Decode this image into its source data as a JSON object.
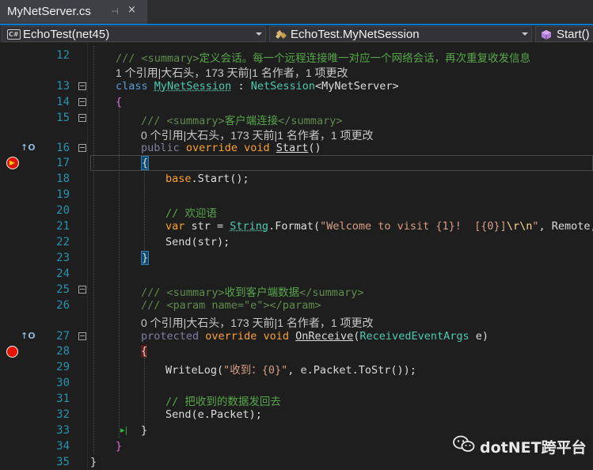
{
  "tab": {
    "title": "MyNetServer.cs",
    "pin": "⊣",
    "close": "×"
  },
  "navbar": {
    "project": "EchoTest(net45)",
    "project_icon": "C#",
    "class": "EchoTest.MyNetSession",
    "member": "Start()"
  },
  "lines": [
    {
      "n": "12"
    },
    {
      "n": "13"
    },
    {
      "n": "14"
    },
    {
      "n": "15"
    },
    {
      "n": "16"
    },
    {
      "n": "17"
    },
    {
      "n": "18"
    },
    {
      "n": "19"
    },
    {
      "n": "20"
    },
    {
      "n": "21"
    },
    {
      "n": "22"
    },
    {
      "n": "23"
    },
    {
      "n": "24"
    },
    {
      "n": "25"
    },
    {
      "n": "26"
    },
    {
      "n": "27"
    },
    {
      "n": "28"
    },
    {
      "n": "29"
    },
    {
      "n": "30"
    },
    {
      "n": "31"
    },
    {
      "n": "32"
    },
    {
      "n": "33"
    },
    {
      "n": "34"
    },
    {
      "n": "35"
    }
  ],
  "code": {
    "l12_prefix": "/// ",
    "l12_tag": "<summary>",
    "l12_text": "定义会话。每一个远程连接唯一对应一个网络会话，再次重复收发信息",
    "lens_12": "1 个引用|大石头，173 天前|1 名作者，1 项更改",
    "l13_kw": "class",
    "l13_name": "MyNetSession",
    "l13_colon": " : ",
    "l13_base": "NetSession",
    "l13_generic": "<MyNetServer>",
    "l14": "{",
    "l15_prefix": "/// ",
    "l15_tag1": "<summary>",
    "l15_text": "客户端连接",
    "l15_tag2": "</summary>",
    "lens_15": "0 个引用|大石头，173 天前|1 名作者，1 项更改",
    "l16_kw1": "public",
    "l16_kw2": "override",
    "l16_kw3": "void",
    "l16_name": "Start",
    "l16_paren": "()",
    "l17": "{",
    "l18_a": "base",
    "l18_b": ".Start",
    "l18_c": "();",
    "l20_comment": "// 欢迎语",
    "l21_kw": "var",
    "l21_a": " str = ",
    "l21_type": "String",
    "l21_b": ".Format(",
    "l21_str1": "\"Welcome to visit {1}!  [{0}]",
    "l21_esc": "\\r\\n",
    "l21_str2": "\"",
    "l21_c": ", Remote,",
    "l22": "Send(str);",
    "l23": "}",
    "l25_prefix": "/// ",
    "l25_tag1": "<summary>",
    "l25_text": "收到客户端数据",
    "l25_tag2": "</summary>",
    "l26_prefix": "/// ",
    "l26_tag": "<param name=\"e\"></param>",
    "lens_26": "0 个引用|大石头，173 天前|1 名作者，1 项更改",
    "l27_kw1": "protected",
    "l27_kw2": "override",
    "l27_kw3": "void",
    "l27_name": "OnReceive",
    "l27_paren1": "(",
    "l27_type": "ReceivedEventArgs",
    "l27_rest": " e)",
    "l28": "{",
    "l29_a": "WriteLog(",
    "l29_str": "\"收到：{0}\"",
    "l29_b": ", e.Packet.ToStr());",
    "l31_comment": "// 把收到的数据发回去",
    "l32": "Send(e.Packet);",
    "l33": "}",
    "l34": "}",
    "l35": "}"
  },
  "glyphs": {
    "override_up": "↑O",
    "run_arrow": "▸|"
  },
  "watermark": "dotNET跨平台",
  "colors": {
    "accent": "#007acc",
    "breakpoint": "#e51400",
    "line_number": "#2b91af",
    "keyword": "#569cd6",
    "type": "#4ec9b0",
    "comment": "#57a64a",
    "string": "#d69d85"
  }
}
